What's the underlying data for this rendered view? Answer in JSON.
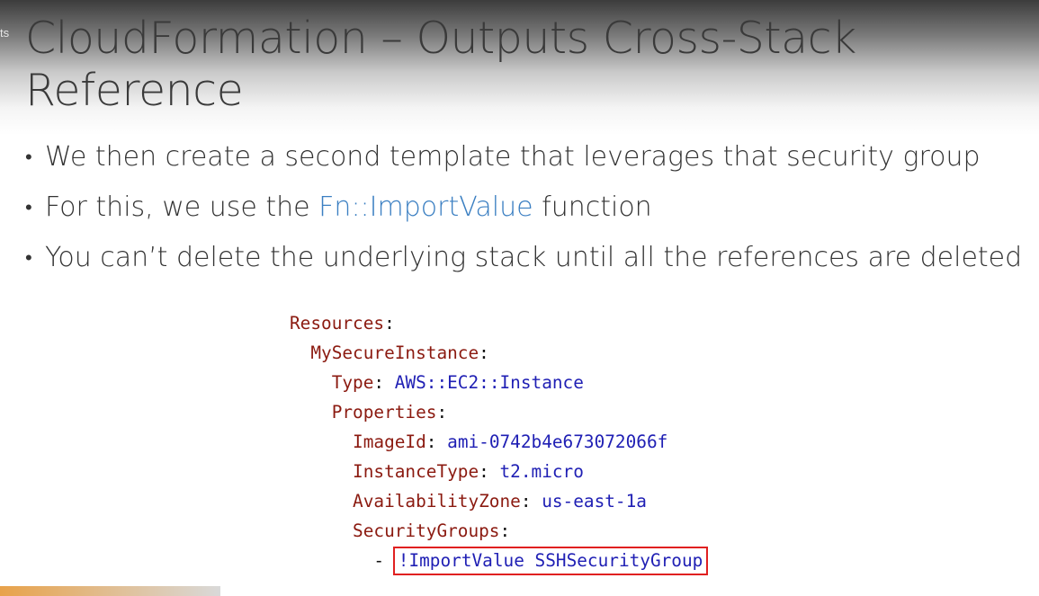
{
  "slide": {
    "corner_text": "ts",
    "title": "CloudFormation – Outputs Cross-Stack Reference",
    "bullet_symbol": "•",
    "bullets": [
      {
        "text": "We then create a second template that leverages that security group"
      },
      {
        "before": "For this, we use the ",
        "highlight": "Fn::ImportValue",
        "after": " function"
      },
      {
        "text": "You can’t delete the underlying stack until all the references are deleted"
      }
    ],
    "colors": {
      "accent_text": "#3b7fc2",
      "code_key": "#8b1a10",
      "code_value": "#1f1fb4",
      "highlight_border": "#e02020"
    }
  },
  "code": {
    "resources_key": "Resources",
    "instance_key": "MySecureInstance",
    "type_key": "Type",
    "type_value": "AWS::EC2::Instance",
    "properties_key": "Properties",
    "imageid_key": "ImageId",
    "imageid_value": "ami-0742b4e673072066f",
    "instancetype_key": "InstanceType",
    "instancetype_value": "t2.micro",
    "az_key": "AvailabilityZone",
    "az_value": "us-east-1a",
    "sg_key": "SecurityGroups",
    "list_dash": "-",
    "import_value": "!ImportValue SSHSecurityGroup"
  }
}
